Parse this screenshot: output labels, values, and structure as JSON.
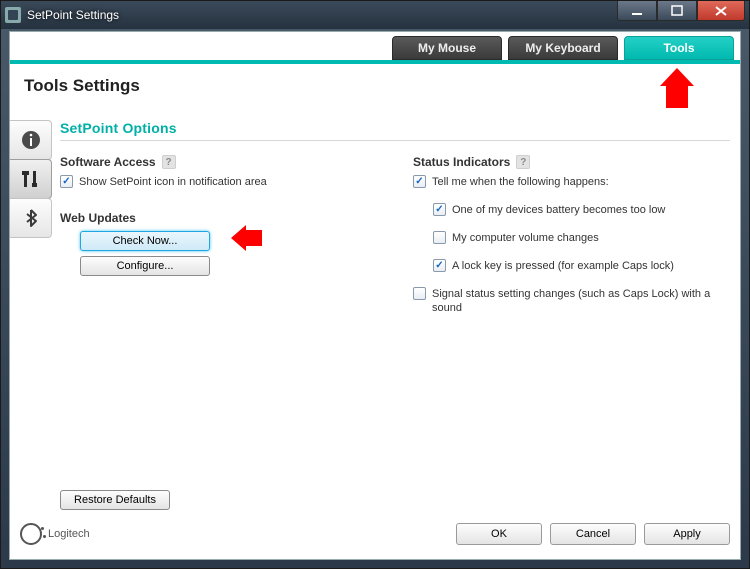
{
  "window": {
    "title": "SetPoint Settings"
  },
  "tabs": {
    "mouse": {
      "label": "My Mouse"
    },
    "keyboard": {
      "label": "My Keyboard"
    },
    "tools": {
      "label": "Tools"
    }
  },
  "page": {
    "heading": "Tools Settings"
  },
  "subheading": "SetPoint Options",
  "software_access": {
    "title": "Software Access",
    "show_tray_label": "Show SetPoint icon in notification area"
  },
  "web_updates": {
    "title": "Web Updates",
    "check_now_label": "Check Now...",
    "configure_label": "Configure..."
  },
  "status_indicators": {
    "title": "Status Indicators",
    "tell_me_label": "Tell me when the following happens:",
    "battery_label": "One of my devices battery becomes too low",
    "volume_label": "My computer volume changes",
    "lock_label": "A lock key is pressed (for example Caps lock)",
    "signal_label": "Signal status setting changes (such as Caps Lock) with a sound"
  },
  "buttons": {
    "restore": "Restore Defaults",
    "ok": "OK",
    "cancel": "Cancel",
    "apply": "Apply"
  },
  "logo": {
    "text": "Logitech"
  }
}
